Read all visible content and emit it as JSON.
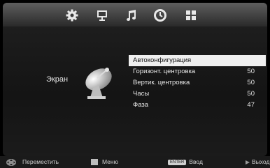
{
  "top_tabs": [
    {
      "icon": "gear-icon"
    },
    {
      "icon": "monitor-icon"
    },
    {
      "icon": "music-note-icon"
    },
    {
      "icon": "clock-icon"
    },
    {
      "icon": "grid-icon"
    }
  ],
  "section": {
    "label": "Экран"
  },
  "menu": {
    "items": [
      {
        "label": "Автоконфигурация",
        "value": "",
        "selected": true
      },
      {
        "label": "Горизонт. центровка",
        "value": "50"
      },
      {
        "label": "Вертик. центровка",
        "value": "50"
      },
      {
        "label": "Часы",
        "value": "50"
      },
      {
        "label": "Фаза",
        "value": "47"
      }
    ]
  },
  "bottom_bar": {
    "move_label": "Переместить",
    "menu_label": "Меню",
    "enter_badge": "ENTER",
    "enter_label": "Ввод",
    "exit_label": "Выход"
  },
  "colors": {
    "selected_bg": "#efefef",
    "text": "#e6e6e6"
  }
}
